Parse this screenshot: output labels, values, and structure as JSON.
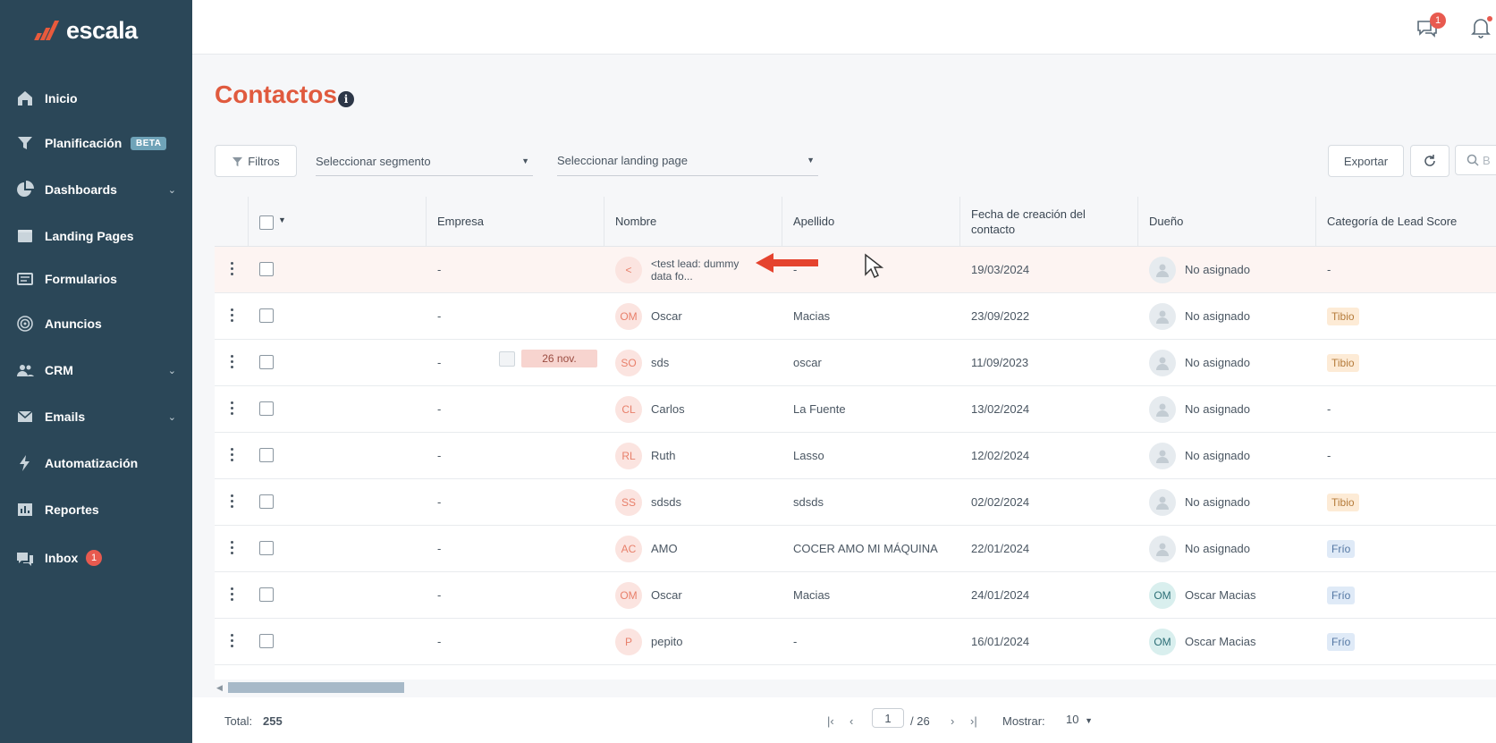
{
  "brand": {
    "name": "escala",
    "accent": "#e05a3e",
    "sidebar_bg": "#2b4758"
  },
  "sidebar": {
    "items": [
      {
        "label": "Inicio",
        "icon": "home-icon"
      },
      {
        "label": "Planificación",
        "icon": "funnel-icon",
        "badge": "BETA"
      },
      {
        "label": "Dashboards",
        "icon": "pie-chart-icon",
        "chevron": true
      },
      {
        "label": "Landing Pages",
        "icon": "browser-icon"
      },
      {
        "label": "Formularios",
        "icon": "form-icon"
      },
      {
        "label": "Anuncios",
        "icon": "target-icon"
      },
      {
        "label": "CRM",
        "icon": "users-icon",
        "chevron": true
      },
      {
        "label": "Emails",
        "icon": "mail-icon",
        "chevron": true
      },
      {
        "label": "Automatización",
        "icon": "lightning-icon"
      },
      {
        "label": "Reportes",
        "icon": "report-icon"
      },
      {
        "label": "Inbox",
        "icon": "chat-icon",
        "count": "1"
      }
    ]
  },
  "topbar": {
    "chat_count": "1"
  },
  "page": {
    "title": "Contactos"
  },
  "toolbar": {
    "filters_label": "Filtros",
    "segment_placeholder": "Seleccionar segmento",
    "landing_placeholder": "Seleccionar landing page",
    "export_label": "Exportar",
    "search_placeholder": "B"
  },
  "table": {
    "columns": [
      "Empresa",
      "Nombre",
      "Apellido",
      "Fecha de creación del contacto",
      "Dueño",
      "Categoría de Lead Score"
    ],
    "rows": [
      {
        "empresa": "-",
        "initials": "<",
        "nombre": "<test lead: dummy data fo...",
        "apellido": "-",
        "fecha": "19/03/2024",
        "dueno": "No asignado",
        "owner_initials": "",
        "lead": "-"
      },
      {
        "empresa": "-",
        "initials": "OM",
        "nombre": "Oscar",
        "apellido": "Macias",
        "fecha": "23/09/2022",
        "dueno": "No asignado",
        "owner_initials": "",
        "lead": "Tibio"
      },
      {
        "empresa": "-",
        "initials": "SO",
        "nombre": "sds",
        "apellido": "oscar",
        "fecha": "11/09/2023",
        "dueno": "No asignado",
        "owner_initials": "",
        "lead": "Tibio",
        "chip": "26 nov."
      },
      {
        "empresa": "-",
        "initials": "CL",
        "nombre": "Carlos",
        "apellido": "La Fuente",
        "fecha": "13/02/2024",
        "dueno": "No asignado",
        "owner_initials": "",
        "lead": "-"
      },
      {
        "empresa": "-",
        "initials": "RL",
        "nombre": "Ruth",
        "apellido": "Lasso",
        "fecha": "12/02/2024",
        "dueno": "No asignado",
        "owner_initials": "",
        "lead": "-"
      },
      {
        "empresa": "-",
        "initials": "SS",
        "nombre": "sdsds",
        "apellido": "sdsds",
        "fecha": "02/02/2024",
        "dueno": "No asignado",
        "owner_initials": "",
        "lead": "Tibio"
      },
      {
        "empresa": "-",
        "initials": "AC",
        "nombre": "AMO",
        "apellido": "COCER AMO MI MÁQUINA",
        "fecha": "22/01/2024",
        "dueno": "No asignado",
        "owner_initials": "",
        "lead": "Frío"
      },
      {
        "empresa": "-",
        "initials": "OM",
        "nombre": "Oscar",
        "apellido": "Macias",
        "fecha": "24/01/2024",
        "dueno": "Oscar Macias",
        "owner_initials": "OM",
        "lead": "Frío"
      },
      {
        "empresa": "-",
        "initials": "P",
        "nombre": "pepito",
        "apellido": "-",
        "fecha": "16/01/2024",
        "dueno": "Oscar Macias",
        "owner_initials": "OM",
        "lead": "Frío"
      }
    ]
  },
  "footer": {
    "total_label": "Total:",
    "total_value": "255",
    "page_value": "1",
    "page_total": "/ 26",
    "show_label": "Mostrar:",
    "show_value": "10"
  }
}
